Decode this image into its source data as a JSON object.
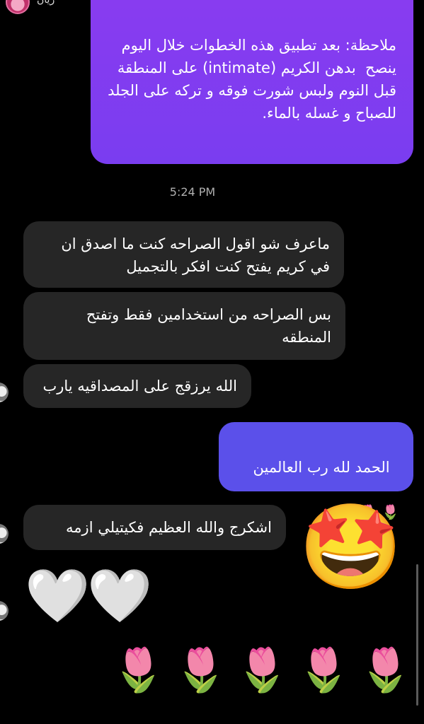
{
  "header": {
    "contact_name": "ريان",
    "close_glyph": "✕"
  },
  "messages": {
    "note_outgoing": "ملاحظة: بعد تطبيق هذه الخطوات خلال اليوم\nينصح  بدهن الكريم (intimate) على المنطقة قبل النوم ولبس شورت فوقه و تركه على الجلد للصباح و غسله بالماء.",
    "timestamp": "5:24 PM",
    "incoming_1": "ماعرف شو اقول الصراحه كنت ما اصدق ان في كريم يفتح كنت افكر بالتجميل",
    "incoming_2": "بس الصراحه من استخدامين فقط وتفتح المنطقه",
    "incoming_3": "الله يرزقج على المصداقيه يارب",
    "outgoing_hamd": "الحمد لله رب العالمين",
    "outgoing_hamd_emojis": "🌷 🌷",
    "incoming_4": "اشكرج والله العظيم فكيتيلي ازمه",
    "star_eyes_emoji": "🤩",
    "heart_emoji": "🤍",
    "tulip_emoji": "🌷"
  },
  "colors": {
    "outgoing_gradient": "#8a3cf0",
    "outgoing_blue": "#5b50ea",
    "incoming_bubble": "#262626",
    "background": "#000000"
  }
}
